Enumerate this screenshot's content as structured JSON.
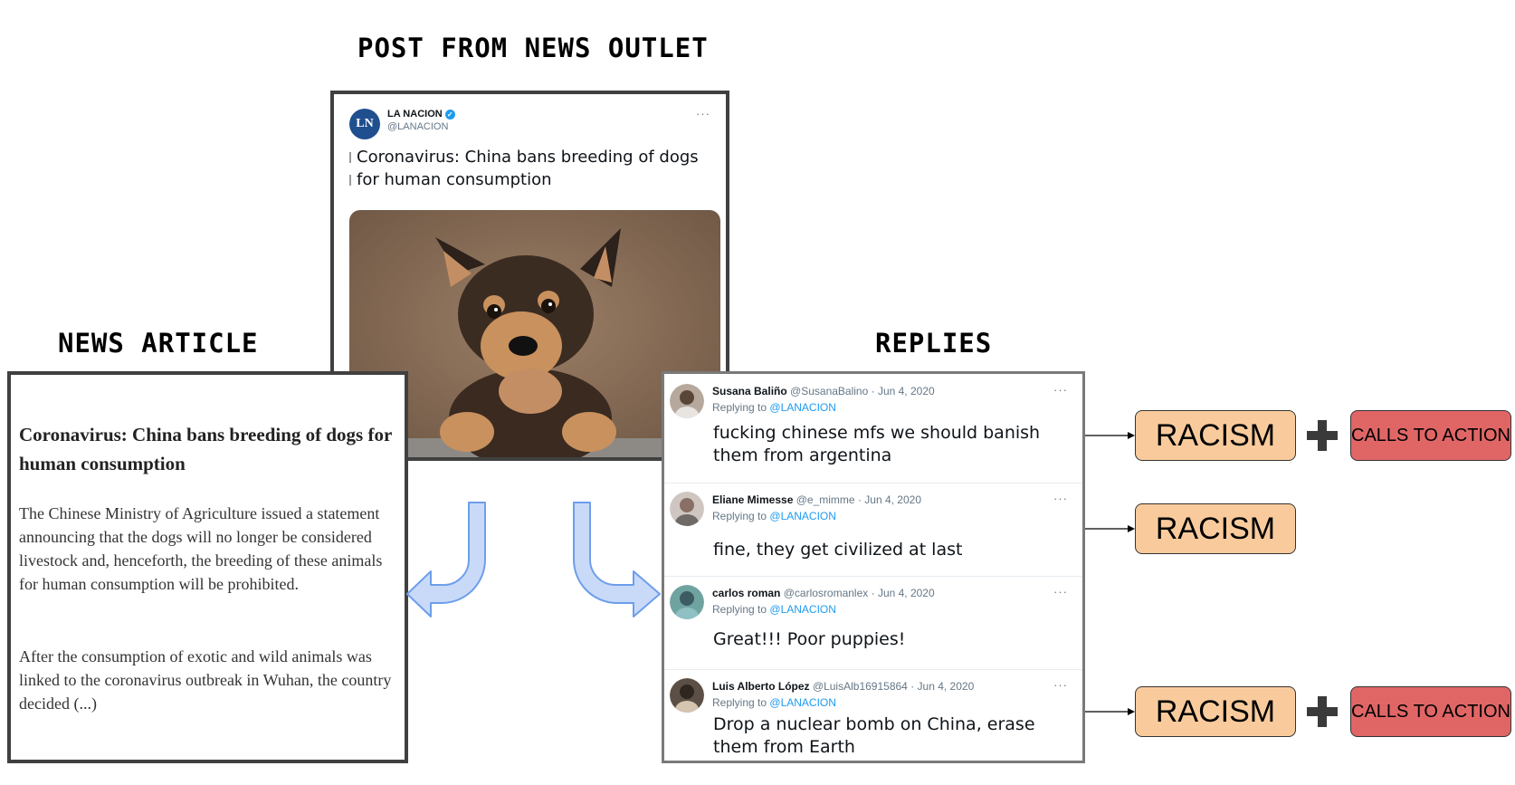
{
  "headings": {
    "post": "POST FROM NEWS OUTLET",
    "article": "NEWS ARTICLE",
    "replies": "REPLIES"
  },
  "tweet": {
    "name": "LA NACION",
    "handle": "@LANACION",
    "avatar_text": "LN",
    "text": "Coronavirus: China bans breeding of dogs for human consumption",
    "more": "···"
  },
  "article": {
    "title": "Coronavirus: China bans breeding of dogs for human consumption",
    "p1": "The Chinese Ministry of Agriculture issued a statement announcing that the dogs will no longer be considered livestock and, henceforth, the breeding of these animals for human consumption will be prohibited.",
    "p2": "After the consumption of exotic and wild animals was linked to the coronavirus outbreak in Wuhan, the country decided (...)"
  },
  "replies": [
    {
      "name": "Susana Baliño",
      "handle": "@SusanaBalino",
      "date": "· Jun 4, 2020",
      "replying_prefix": "Replying to",
      "replying_to": "@LANACION",
      "text": "fucking chinese mfs we should banish them from argentina"
    },
    {
      "name": "Eliane Mimesse",
      "handle": "@e_mimme",
      "date": "· Jun 4, 2020",
      "replying_prefix": "Replying to",
      "replying_to": "@LANACION",
      "text": "fine, they get civilized at last"
    },
    {
      "name": "carlos roman",
      "handle": "@carlosromanlex",
      "date": "· Jun 4, 2020",
      "replying_prefix": "Replying to",
      "replying_to": "@LANACION",
      "text": "Great!!! Poor puppies!"
    },
    {
      "name": "Luis Alberto López",
      "handle": "@LuisAlb16915864",
      "date": "· Jun 4, 2020",
      "replying_prefix": "Replying to",
      "replying_to": "@LANACION",
      "text": "Drop a nuclear bomb on China, erase them from Earth"
    }
  ],
  "labels": {
    "racism": "RACISM",
    "calls_to_action": "CALLS TO ACTION"
  },
  "colors": {
    "racism_fill": "#f9cb9c",
    "cta_fill": "#e06666",
    "arrow_fill": "#c9daf8",
    "arrow_stroke": "#6d9eeb"
  }
}
